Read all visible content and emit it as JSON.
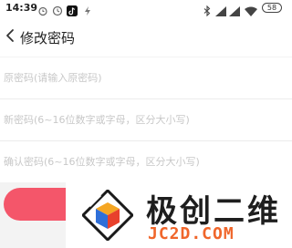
{
  "status_bar": {
    "time": "14:39",
    "battery": "58",
    "left_icons": [
      "alarm-clock-icon",
      "timer-icon",
      "tiktok-icon",
      "bolt-icon",
      "dots-icon"
    ],
    "right_icons": [
      "bluetooth-icon",
      "signal-icon",
      "signal-icon",
      "wifi-icon"
    ]
  },
  "header": {
    "title": "修改密码"
  },
  "form": {
    "old_password": {
      "placeholder": "原密码(请输入原密码)",
      "value": ""
    },
    "new_password": {
      "placeholder": "新密码(6~16位数字或字母，区分大小写)",
      "value": ""
    },
    "confirm_password": {
      "placeholder": "确认密码(6~16位数字或字母，区分大小写)",
      "value": ""
    },
    "submit_label": ""
  },
  "watermark": {
    "name": "极创二维",
    "url": "JC2D.COM"
  },
  "colors": {
    "accent": "#f4566a",
    "page_background": "#f3f3f3",
    "watermark_url": "#f0662b"
  }
}
